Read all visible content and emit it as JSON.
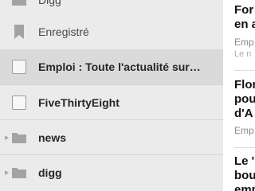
{
  "sidebar": {
    "items": [
      {
        "label": "Digg"
      },
      {
        "label": "Enregistré"
      },
      {
        "label": "Emploi : Toute l'actualité sur…"
      },
      {
        "label": "FiveThirtyEight"
      },
      {
        "label": "news"
      },
      {
        "label": "digg"
      }
    ]
  },
  "articles": [
    {
      "title_line1": "For",
      "title_line2": "en a",
      "source": "Emp",
      "meta": "Le n"
    },
    {
      "title_line1": "Flor",
      "title_line2": "pou",
      "title_line3": "d'A",
      "source": "Emp"
    },
    {
      "title_line1": "Le '",
      "title_line2": "bou",
      "title_line3": "emp"
    }
  ],
  "colors": {
    "sidebar_bg": "#ebebeb",
    "selected_bg": "#dadada",
    "content_bg": "#ffffff"
  }
}
